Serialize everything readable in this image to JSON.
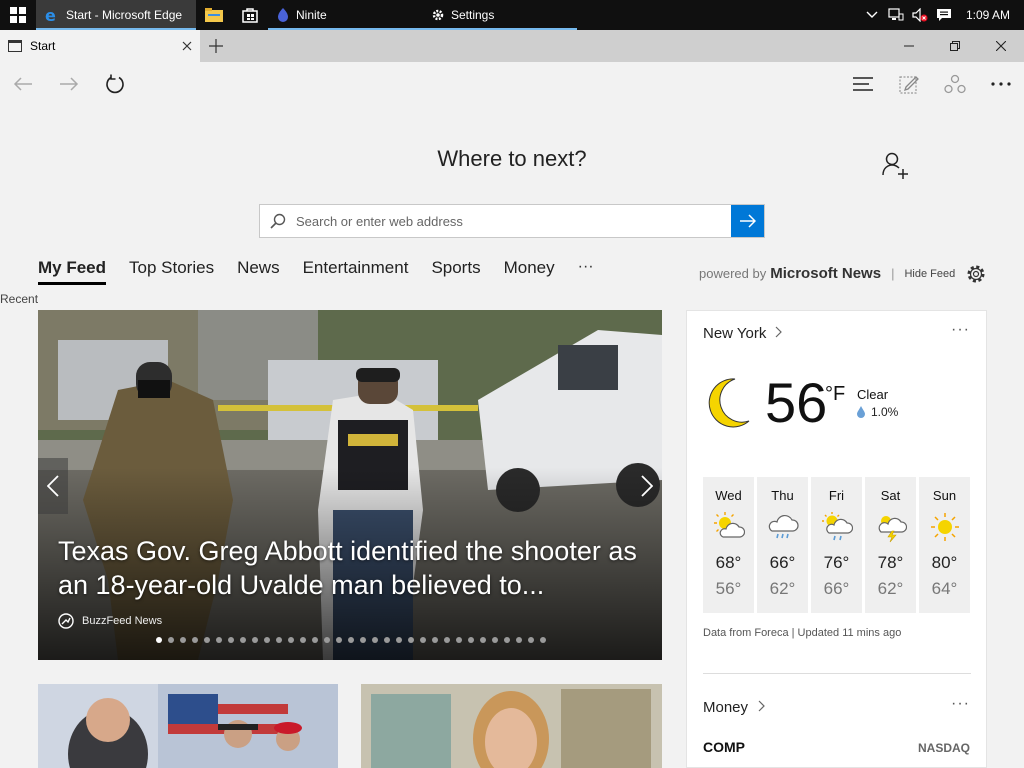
{
  "taskbar": {
    "apps": [
      {
        "label": "Start - Microsoft Edge",
        "icon": "edge-icon",
        "state": "active"
      },
      {
        "label": "",
        "icon": "file-explorer-icon",
        "state": "pinned"
      },
      {
        "label": "",
        "icon": "store-icon",
        "state": "pinned"
      },
      {
        "label": "Ninite",
        "icon": "ninite-icon",
        "state": "open"
      },
      {
        "label": "Settings",
        "icon": "gear-icon",
        "state": "open"
      }
    ],
    "clock": "1:09 AM"
  },
  "browser": {
    "tab_title": "Start",
    "accent_color": "#0078d7"
  },
  "page": {
    "heading": "Where to next?",
    "search_placeholder": "Search or enter web address",
    "feed_tabs": [
      "My Feed",
      "Top Stories",
      "News",
      "Entertainment",
      "Sports",
      "Money"
    ],
    "active_feed_tab": "My Feed",
    "more": "···",
    "powered_by": "powered by",
    "powered_brand": "Microsoft News",
    "separator": "|",
    "hide_feed": "Hide Feed",
    "recent": "Recent"
  },
  "hero": {
    "headline": "Texas Gov. Greg Abbott identified the shooter as an 18-year-old Uvalde man believed to...",
    "source": "BuzzFeed News",
    "slide_count": 33,
    "active_slide": 1
  },
  "weather": {
    "location": "New York",
    "menu": "···",
    "temperature": "56",
    "unit": "°F",
    "condition": "Clear",
    "precip": "1.0%",
    "forecast": [
      {
        "day": "Wed",
        "high": "68°",
        "low": "56°",
        "icon": "partly-cloudy-icon"
      },
      {
        "day": "Thu",
        "high": "66°",
        "low": "62°",
        "icon": "rain-cloud-icon"
      },
      {
        "day": "Fri",
        "high": "76°",
        "low": "66°",
        "icon": "sun-rain-icon"
      },
      {
        "day": "Sat",
        "high": "78°",
        "low": "62°",
        "icon": "thunderstorm-icon"
      },
      {
        "day": "Sun",
        "high": "80°",
        "low": "64°",
        "icon": "sun-icon"
      }
    ],
    "source": "Data from Foreca | Updated 11 mins ago"
  },
  "money": {
    "title": "Money",
    "menu": "···",
    "symbol": "COMP",
    "exchange": "NASDAQ"
  }
}
